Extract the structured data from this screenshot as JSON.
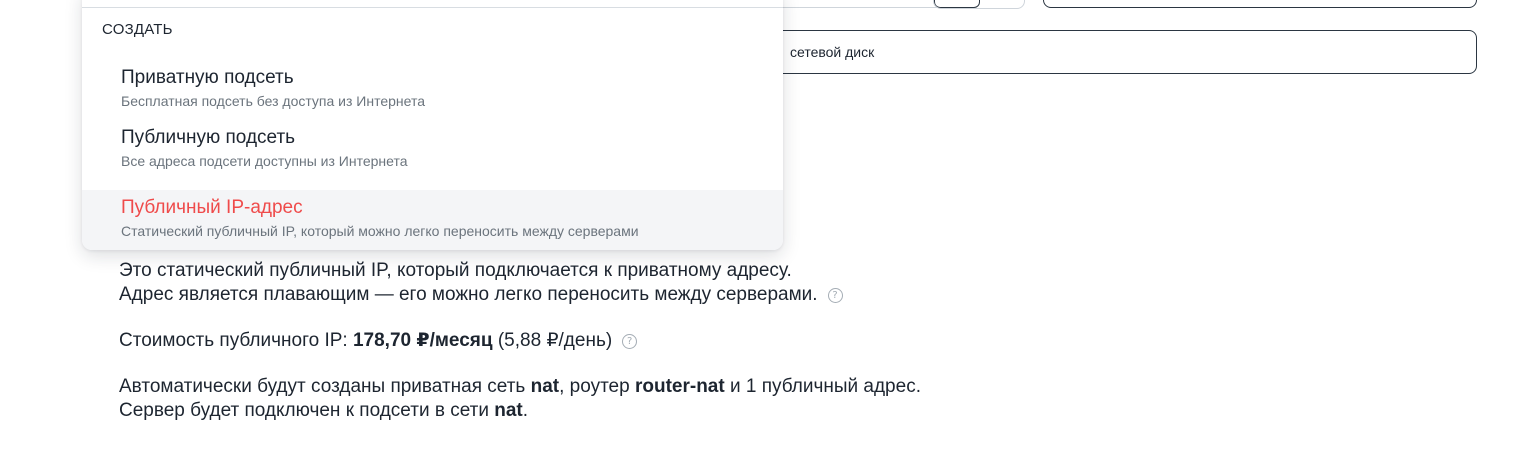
{
  "background": {
    "disk_select_text": "сетевой диск"
  },
  "dropdown": {
    "section_label": "СОЗДАТЬ",
    "items": [
      {
        "title": "Приватную подсеть",
        "description": "Бесплатная подсеть без доступа из Интернета"
      },
      {
        "title": "Публичную подсеть",
        "description": "Все адреса подсети доступны из Интернета"
      },
      {
        "title": "Публичный IP-адрес",
        "description": "Статический публичный IP, который можно легко переносить между серверами"
      }
    ],
    "highlight_color": "#ef4b4b"
  },
  "info": {
    "line1": "Это статический публичный IP, который подключается к приватному адресу.",
    "line2": "Адрес является плавающим — его можно легко переносить между серверами.",
    "price_prefix": "Стоимость публичного IP: ",
    "price_month": "178,70 ₽/месяц",
    "price_day": " (5,88 ₽/день)",
    "auto_prefix": "Автоматически будут созданы приватная сеть ",
    "net_name": "nat",
    "auto_mid": ", роутер ",
    "router_name": "router-nat",
    "auto_suffix": " и 1 публичный адрес.",
    "server_prefix": "Сервер будет подключен к подсети в сети ",
    "server_net": "nat",
    "server_suffix": ".",
    "help_glyph": "?"
  }
}
